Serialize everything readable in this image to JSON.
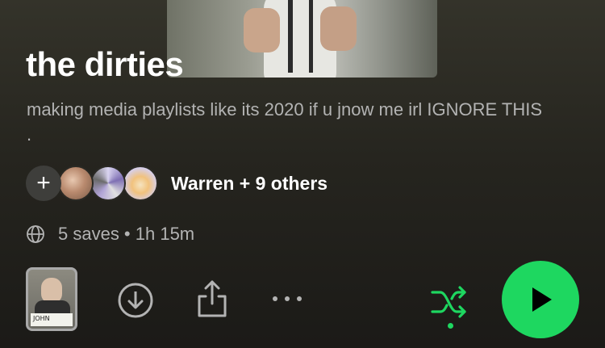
{
  "playlist": {
    "title": "the dirties",
    "description": "making media playlists like its 2020 if u jnow me irl IGNORE THIS ."
  },
  "collaborators": {
    "add_label": "+",
    "text": "Warren + 9 others"
  },
  "meta": {
    "stats": "5 saves • 1h 15m"
  },
  "thumbnail": {
    "label": "JOHN"
  },
  "colors": {
    "accent": "#1ed760",
    "text_secondary": "#b3b3b3",
    "background": "#26251f"
  },
  "icons": {
    "globe": "globe-icon",
    "download": "download-icon",
    "share": "share-icon",
    "more": "more-icon",
    "shuffle": "shuffle-icon",
    "play": "play-icon"
  }
}
